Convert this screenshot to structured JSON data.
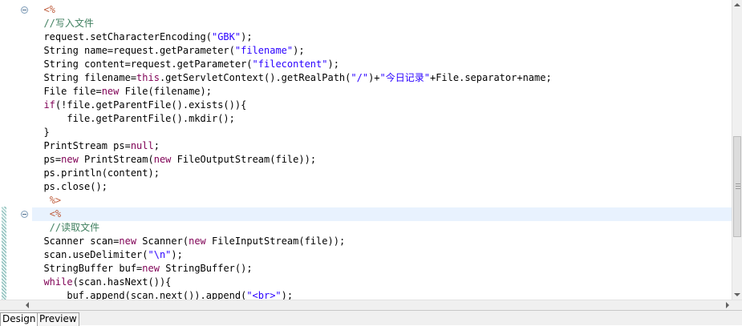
{
  "editor": {
    "current_line_index": 15,
    "lines": [
      {
        "fold": true,
        "tokens": [
          {
            "t": "  ",
            "c": "text"
          },
          {
            "t": "<%",
            "c": "tag"
          }
        ]
      },
      {
        "fold": false,
        "tokens": [
          {
            "t": "  //写入文件",
            "c": "com"
          }
        ]
      },
      {
        "fold": false,
        "tokens": [
          {
            "t": "  request.setCharacterEncoding(",
            "c": "text"
          },
          {
            "t": "\"GBK\"",
            "c": "str"
          },
          {
            "t": ");",
            "c": "text"
          }
        ]
      },
      {
        "fold": false,
        "tokens": [
          {
            "t": "  String name=request.getParameter(",
            "c": "text"
          },
          {
            "t": "\"filename\"",
            "c": "str"
          },
          {
            "t": ");",
            "c": "text"
          }
        ]
      },
      {
        "fold": false,
        "tokens": [
          {
            "t": "  String content=request.getParameter(",
            "c": "text"
          },
          {
            "t": "\"filecontent\"",
            "c": "str"
          },
          {
            "t": ");",
            "c": "text"
          }
        ]
      },
      {
        "fold": false,
        "tokens": [
          {
            "t": "  String filename=",
            "c": "text"
          },
          {
            "t": "this",
            "c": "kw"
          },
          {
            "t": ".getServletContext().getRealPath(",
            "c": "text"
          },
          {
            "t": "\"/\"",
            "c": "str"
          },
          {
            "t": ")+",
            "c": "text"
          },
          {
            "t": "\"今日记录\"",
            "c": "str"
          },
          {
            "t": "+File.separator+name;",
            "c": "text"
          }
        ]
      },
      {
        "fold": false,
        "tokens": [
          {
            "t": "  File file=",
            "c": "text"
          },
          {
            "t": "new",
            "c": "kw"
          },
          {
            "t": " File(filename);",
            "c": "text"
          }
        ]
      },
      {
        "fold": false,
        "tokens": [
          {
            "t": "  ",
            "c": "text"
          },
          {
            "t": "if",
            "c": "kw"
          },
          {
            "t": "(!file.getParentFile().exists()){",
            "c": "text"
          }
        ]
      },
      {
        "fold": false,
        "tokens": [
          {
            "t": "      file.getParentFile().mkdir();",
            "c": "text"
          }
        ]
      },
      {
        "fold": false,
        "tokens": [
          {
            "t": "  }",
            "c": "text"
          }
        ]
      },
      {
        "fold": false,
        "tokens": [
          {
            "t": "  PrintStream ps=",
            "c": "text"
          },
          {
            "t": "null",
            "c": "kw"
          },
          {
            "t": ";",
            "c": "text"
          }
        ]
      },
      {
        "fold": false,
        "tokens": [
          {
            "t": "  ps=",
            "c": "text"
          },
          {
            "t": "new",
            "c": "kw"
          },
          {
            "t": " PrintStream(",
            "c": "text"
          },
          {
            "t": "new",
            "c": "kw"
          },
          {
            "t": " FileOutputStream(file));",
            "c": "text"
          }
        ]
      },
      {
        "fold": false,
        "tokens": [
          {
            "t": "  ps.println(content);",
            "c": "text"
          }
        ]
      },
      {
        "fold": false,
        "tokens": [
          {
            "t": "  ps.close();",
            "c": "text"
          }
        ]
      },
      {
        "fold": false,
        "tokens": [
          {
            "t": "   ",
            "c": "text"
          },
          {
            "t": "%>",
            "c": "tag"
          }
        ]
      },
      {
        "fold": true,
        "tokens": [
          {
            "t": "   ",
            "c": "text"
          },
          {
            "t": "<%",
            "c": "tag"
          }
        ]
      },
      {
        "fold": false,
        "tokens": [
          {
            "t": "   //读取文件",
            "c": "com"
          }
        ]
      },
      {
        "fold": false,
        "tokens": [
          {
            "t": "  Scanner scan=",
            "c": "text"
          },
          {
            "t": "new",
            "c": "kw"
          },
          {
            "t": " Scanner(",
            "c": "text"
          },
          {
            "t": "new",
            "c": "kw"
          },
          {
            "t": " FileInputStream(file));",
            "c": "text"
          }
        ]
      },
      {
        "fold": false,
        "tokens": [
          {
            "t": "  scan.useDelimiter(",
            "c": "text"
          },
          {
            "t": "\"\\n\"",
            "c": "str"
          },
          {
            "t": ");",
            "c": "text"
          }
        ]
      },
      {
        "fold": false,
        "tokens": [
          {
            "t": "  StringBuffer buf=",
            "c": "text"
          },
          {
            "t": "new",
            "c": "kw"
          },
          {
            "t": " StringBuffer();",
            "c": "text"
          }
        ]
      },
      {
        "fold": false,
        "tokens": [
          {
            "t": "  ",
            "c": "text"
          },
          {
            "t": "while",
            "c": "kw"
          },
          {
            "t": "(scan.hasNext()){",
            "c": "text"
          }
        ]
      },
      {
        "fold": false,
        "tokens": [
          {
            "t": "      buf.append(scan.next()).append(",
            "c": "text"
          },
          {
            "t": "\"<br>\"",
            "c": "str"
          },
          {
            "t": ");",
            "c": "text"
          }
        ]
      }
    ]
  },
  "tabs": [
    {
      "label": "Design",
      "active": true
    },
    {
      "label": "Preview",
      "active": false
    }
  ]
}
